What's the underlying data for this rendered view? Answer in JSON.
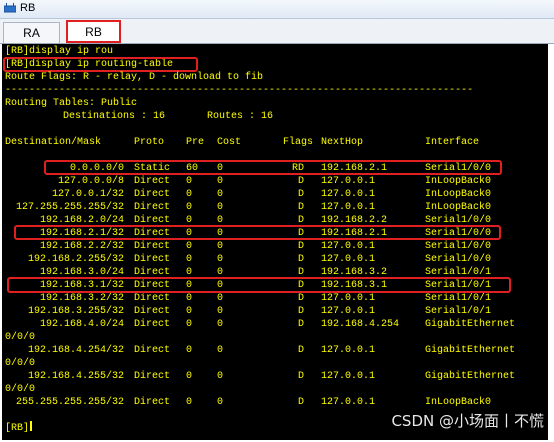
{
  "window": {
    "title": "RB"
  },
  "tabs": [
    {
      "label": "RA"
    },
    {
      "label": "RB"
    }
  ],
  "terminal": {
    "cmd1": "[RB]display ip rou",
    "cmd2": "[RB]display ip routing-table",
    "route_flags": "Route Flags: R - relay, D - download to fib",
    "separator": "------------------------------------------------------------------------------",
    "routing_tables": "Routing Tables: Public",
    "counts": "Destinations : 16       Routes : 16",
    "headers": {
      "dest": "Destination/Mask",
      "proto": "Proto",
      "pre": "Pre",
      "cost": "Cost",
      "flags": "Flags",
      "nexthop": "NextHop",
      "iface": "Interface"
    },
    "rows": [
      {
        "dest": "0.0.0.0/0",
        "proto": "Static",
        "pre": "60",
        "cost": "0",
        "flags": "RD",
        "nexthop": "192.168.2.1",
        "iface": "Serial1/0/0"
      },
      {
        "dest": "127.0.0.0/8",
        "proto": "Direct",
        "pre": "0",
        "cost": "0",
        "flags": "D",
        "nexthop": "127.0.0.1",
        "iface": "InLoopBack0"
      },
      {
        "dest": "127.0.0.1/32",
        "proto": "Direct",
        "pre": "0",
        "cost": "0",
        "flags": "D",
        "nexthop": "127.0.0.1",
        "iface": "InLoopBack0"
      },
      {
        "dest": "127.255.255.255/32",
        "proto": "Direct",
        "pre": "0",
        "cost": "0",
        "flags": "D",
        "nexthop": "127.0.0.1",
        "iface": "InLoopBack0"
      },
      {
        "dest": "192.168.2.0/24",
        "proto": "Direct",
        "pre": "0",
        "cost": "0",
        "flags": "D",
        "nexthop": "192.168.2.2",
        "iface": "Serial1/0/0"
      },
      {
        "dest": "192.168.2.1/32",
        "proto": "Direct",
        "pre": "0",
        "cost": "0",
        "flags": "D",
        "nexthop": "192.168.2.1",
        "iface": "Serial1/0/0"
      },
      {
        "dest": "192.168.2.2/32",
        "proto": "Direct",
        "pre": "0",
        "cost": "0",
        "flags": "D",
        "nexthop": "127.0.0.1",
        "iface": "Serial1/0/0"
      },
      {
        "dest": "192.168.2.255/32",
        "proto": "Direct",
        "pre": "0",
        "cost": "0",
        "flags": "D",
        "nexthop": "127.0.0.1",
        "iface": "Serial1/0/0"
      },
      {
        "dest": "192.168.3.0/24",
        "proto": "Direct",
        "pre": "0",
        "cost": "0",
        "flags": "D",
        "nexthop": "192.168.3.2",
        "iface": "Serial1/0/1"
      },
      {
        "dest": "192.168.3.1/32",
        "proto": "Direct",
        "pre": "0",
        "cost": "0",
        "flags": "D",
        "nexthop": "192.168.3.1",
        "iface": "Serial1/0/1"
      },
      {
        "dest": "192.168.3.2/32",
        "proto": "Direct",
        "pre": "0",
        "cost": "0",
        "flags": "D",
        "nexthop": "127.0.0.1",
        "iface": "Serial1/0/1"
      },
      {
        "dest": "192.168.3.255/32",
        "proto": "Direct",
        "pre": "0",
        "cost": "0",
        "flags": "D",
        "nexthop": "127.0.0.1",
        "iface": "Serial1/0/1"
      },
      {
        "dest": "192.168.4.0/24",
        "proto": "Direct",
        "pre": "0",
        "cost": "0",
        "flags": "D",
        "nexthop": "192.168.4.254",
        "iface": "GigabitEthernet"
      },
      {
        "wrap": "0/0/0"
      },
      {
        "dest": "192.168.4.254/32",
        "proto": "Direct",
        "pre": "0",
        "cost": "0",
        "flags": "D",
        "nexthop": "127.0.0.1",
        "iface": "GigabitEthernet"
      },
      {
        "wrap": "0/0/0"
      },
      {
        "dest": "192.168.4.255/32",
        "proto": "Direct",
        "pre": "0",
        "cost": "0",
        "flags": "D",
        "nexthop": "127.0.0.1",
        "iface": "GigabitEthernet"
      },
      {
        "wrap": "0/0/0"
      },
      {
        "dest": "255.255.255.255/32",
        "proto": "Direct",
        "pre": "0",
        "cost": "0",
        "flags": "D",
        "nexthop": "127.0.0.1",
        "iface": "InLoopBack0"
      }
    ],
    "prompt": "[RB]"
  },
  "watermark": "CSDN @小场面丨不慌",
  "colors": {
    "terminal_bg": "#000000",
    "terminal_text": "#ffff00",
    "highlight": "#e02020"
  }
}
